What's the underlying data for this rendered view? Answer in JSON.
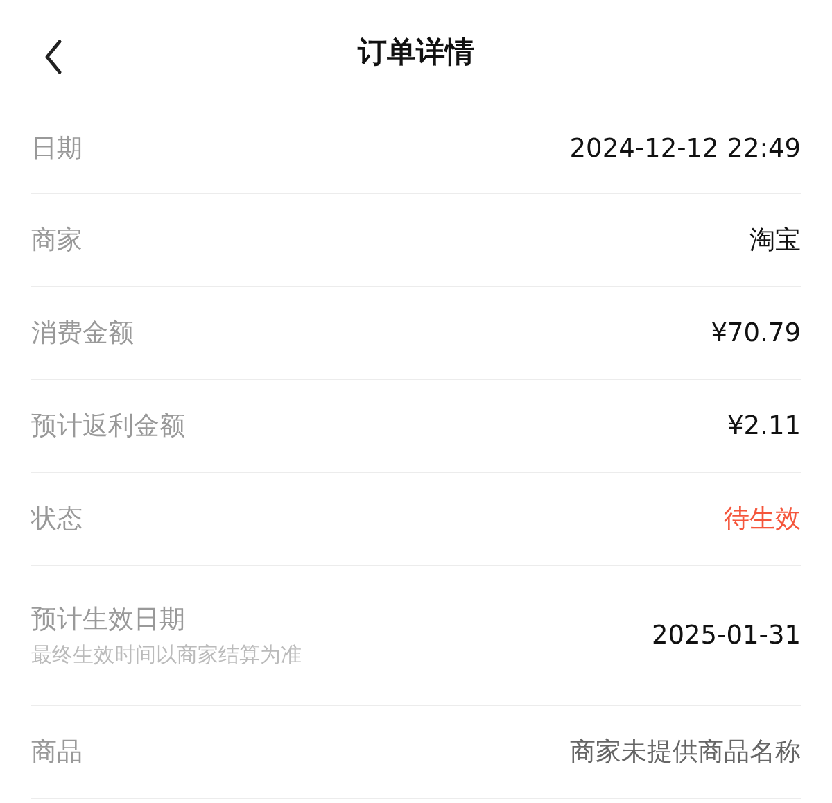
{
  "header": {
    "title": "订单详情"
  },
  "rows": [
    {
      "label": "日期",
      "value": "2024-12-12 22:49",
      "kind": "normal"
    },
    {
      "label": "商家",
      "value": "淘宝",
      "kind": "normal"
    },
    {
      "label": "消费金额",
      "value": "¥70.79",
      "kind": "normal"
    },
    {
      "label": "预计返利金额",
      "value": "¥2.11",
      "kind": "normal"
    },
    {
      "label": "状态",
      "value": "待生效",
      "kind": "highlight"
    },
    {
      "label": "预计生效日期",
      "note": "最终生效时间以商家结算为准",
      "value": "2025-01-31",
      "kind": "normal"
    },
    {
      "label": "商品",
      "value": "商家未提供商品名称",
      "kind": "muted"
    }
  ]
}
